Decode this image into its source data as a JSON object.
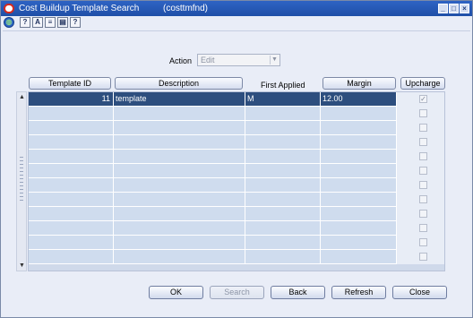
{
  "window": {
    "title": "Cost Buildup Template Search",
    "code": "(costtmfnd)"
  },
  "toolbar": {
    "icons": [
      "globe-icon",
      "help-icon",
      "spellcheck-icon",
      "note-icon",
      "document-icon",
      "question-icon"
    ]
  },
  "form": {
    "action_label": "Action",
    "action_value": "Edit"
  },
  "table": {
    "columns": {
      "template_id": "Template ID",
      "description": "Description",
      "first_applied": "First Applied",
      "margin": "Margin",
      "upcharge": "Upcharge"
    },
    "rows": [
      {
        "template_id": "11",
        "description": "template",
        "first_applied": "M",
        "margin": "12.00",
        "upcharge": true
      }
    ],
    "empty_row_count": 11
  },
  "buttons": {
    "ok": "OK",
    "search": "Search",
    "back": "Back",
    "refresh": "Refresh",
    "close": "Close"
  },
  "colors": {
    "titlebar": "#1f4fa7",
    "selected_row": "#2d4e7e",
    "grid_row": "#cfdcee",
    "panel": "#e9edf7"
  }
}
